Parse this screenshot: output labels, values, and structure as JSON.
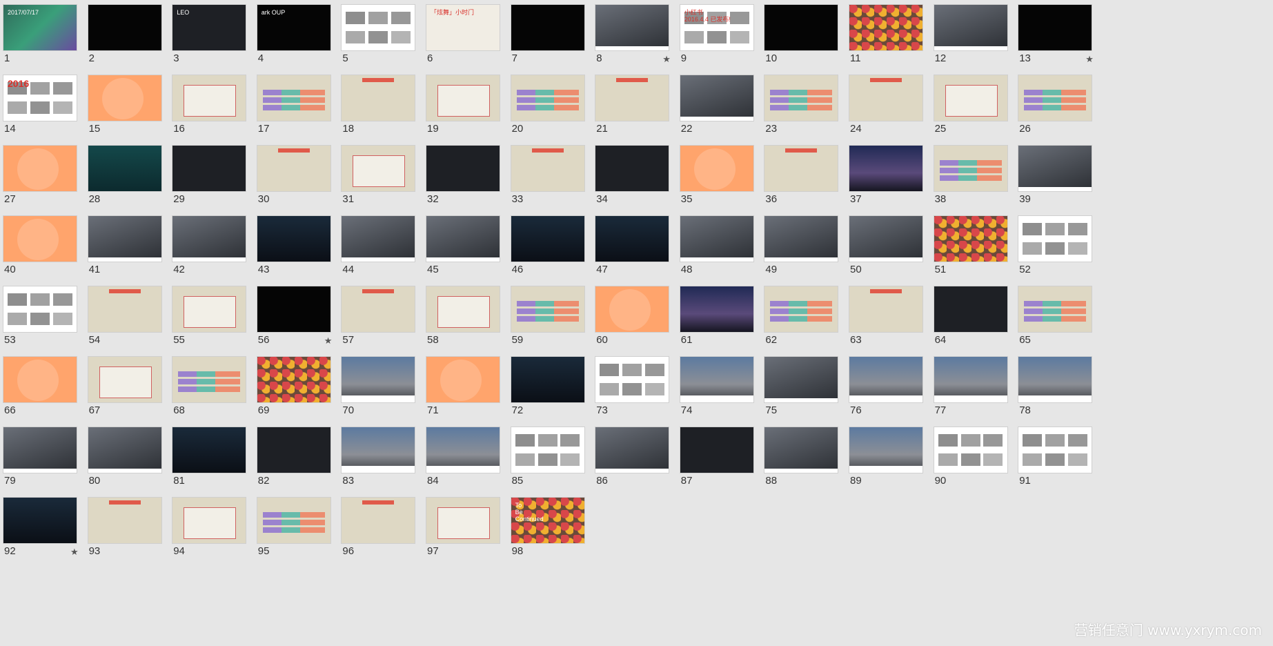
{
  "view": "slide-sorter",
  "watermark": "营销任意门 www.yxrym.com",
  "slides": [
    {
      "number": "1",
      "style": "green",
      "text": "2017/07/17"
    },
    {
      "number": "2",
      "style": "black"
    },
    {
      "number": "3",
      "style": "dark",
      "text": "LEO"
    },
    {
      "number": "4",
      "style": "black",
      "text": "ark  OUP"
    },
    {
      "number": "5",
      "style": "white"
    },
    {
      "number": "6",
      "style": "pink",
      "text": "「炫舞」小时门"
    },
    {
      "number": "7",
      "style": "black"
    },
    {
      "number": "8",
      "style": "photo",
      "star": "★"
    },
    {
      "number": "9",
      "style": "white",
      "text": "小红书\n2016.4.4 已发布!"
    },
    {
      "number": "10",
      "style": "black"
    },
    {
      "number": "11",
      "style": "dots"
    },
    {
      "number": "12",
      "style": "photo"
    },
    {
      "number": "13",
      "style": "black",
      "star": "★"
    },
    {
      "number": "14",
      "style": "white",
      "big": "2016"
    },
    {
      "number": "15",
      "style": "peach"
    },
    {
      "number": "16",
      "style": "cream"
    },
    {
      "number": "17",
      "style": "cream"
    },
    {
      "number": "18",
      "style": "cream"
    },
    {
      "number": "19",
      "style": "cream"
    },
    {
      "number": "20",
      "style": "cream"
    },
    {
      "number": "21",
      "style": "cream"
    },
    {
      "number": "22",
      "style": "photo"
    },
    {
      "number": "23",
      "style": "cream"
    },
    {
      "number": "24",
      "style": "cream"
    },
    {
      "number": "25",
      "style": "cream"
    },
    {
      "number": "26",
      "style": "cream"
    },
    {
      "number": "27",
      "style": "peach"
    },
    {
      "number": "28",
      "style": "teal"
    },
    {
      "number": "29",
      "style": "dark"
    },
    {
      "number": "30",
      "style": "cream"
    },
    {
      "number": "31",
      "style": "cream"
    },
    {
      "number": "32",
      "style": "dark"
    },
    {
      "number": "33",
      "style": "cream"
    },
    {
      "number": "34",
      "style": "dark"
    },
    {
      "number": "35",
      "style": "peach"
    },
    {
      "number": "36",
      "style": "cream"
    },
    {
      "number": "37",
      "style": "city"
    },
    {
      "number": "38",
      "style": "cream"
    },
    {
      "number": "39",
      "style": "photo"
    },
    {
      "number": "40",
      "style": "peach"
    },
    {
      "number": "41",
      "style": "photo"
    },
    {
      "number": "42",
      "style": "photo"
    },
    {
      "number": "43",
      "style": "night"
    },
    {
      "number": "44",
      "style": "photo"
    },
    {
      "number": "45",
      "style": "photo"
    },
    {
      "number": "46",
      "style": "night"
    },
    {
      "number": "47",
      "style": "night"
    },
    {
      "number": "48",
      "style": "photo"
    },
    {
      "number": "49",
      "style": "photo"
    },
    {
      "number": "50",
      "style": "photo"
    },
    {
      "number": "51",
      "style": "dots"
    },
    {
      "number": "52",
      "style": "white"
    },
    {
      "number": "53",
      "style": "white"
    },
    {
      "number": "54",
      "style": "cream"
    },
    {
      "number": "55",
      "style": "cream"
    },
    {
      "number": "56",
      "style": "black",
      "star": "★"
    },
    {
      "number": "57",
      "style": "cream"
    },
    {
      "number": "58",
      "style": "cream"
    },
    {
      "number": "59",
      "style": "cream"
    },
    {
      "number": "60",
      "style": "peach"
    },
    {
      "number": "61",
      "style": "city"
    },
    {
      "number": "62",
      "style": "cream"
    },
    {
      "number": "63",
      "style": "cream"
    },
    {
      "number": "64",
      "style": "dark"
    },
    {
      "number": "65",
      "style": "cream"
    },
    {
      "number": "66",
      "style": "peach"
    },
    {
      "number": "67",
      "style": "cream"
    },
    {
      "number": "68",
      "style": "cream"
    },
    {
      "number": "69",
      "style": "dots"
    },
    {
      "number": "70",
      "style": "street"
    },
    {
      "number": "71",
      "style": "peach"
    },
    {
      "number": "72",
      "style": "night"
    },
    {
      "number": "73",
      "style": "white"
    },
    {
      "number": "74",
      "style": "street"
    },
    {
      "number": "75",
      "style": "photo"
    },
    {
      "number": "76",
      "style": "street"
    },
    {
      "number": "77",
      "style": "street"
    },
    {
      "number": "78",
      "style": "street"
    },
    {
      "number": "79",
      "style": "photo"
    },
    {
      "number": "80",
      "style": "photo"
    },
    {
      "number": "81",
      "style": "night"
    },
    {
      "number": "82",
      "style": "dark"
    },
    {
      "number": "83",
      "style": "street"
    },
    {
      "number": "84",
      "style": "street"
    },
    {
      "number": "85",
      "style": "white"
    },
    {
      "number": "86",
      "style": "photo"
    },
    {
      "number": "87",
      "style": "dark"
    },
    {
      "number": "88",
      "style": "photo"
    },
    {
      "number": "89",
      "style": "street"
    },
    {
      "number": "90",
      "style": "white"
    },
    {
      "number": "91",
      "style": "white"
    },
    {
      "number": "92",
      "style": "night",
      "star": "★"
    },
    {
      "number": "93",
      "style": "cream"
    },
    {
      "number": "94",
      "style": "cream"
    },
    {
      "number": "95",
      "style": "cream"
    },
    {
      "number": "96",
      "style": "cream"
    },
    {
      "number": "97",
      "style": "cream"
    },
    {
      "number": "98",
      "style": "dots",
      "text": "To\nBe\nContinued"
    }
  ]
}
